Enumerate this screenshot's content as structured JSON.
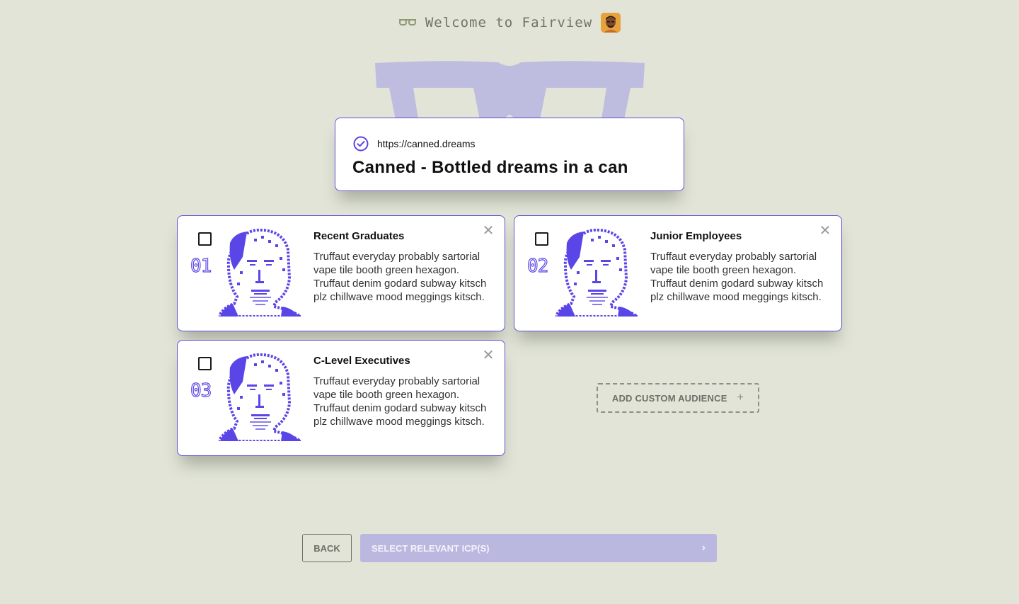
{
  "header": {
    "title": "Welcome to Fairview",
    "icon": "glasses-icon",
    "avatar": "user-avatar"
  },
  "site": {
    "url": "https://canned.dreams",
    "title": "Canned - Bottled dreams in a can",
    "status_icon": "check-circle-icon"
  },
  "icps": [
    {
      "number": "01",
      "name": "Recent Graduates",
      "description": "Truffaut everyday probably sartorial vape tile booth green hexagon. Truffaut denim godard subway kitsch plz chillwave mood meggings kitsch."
    },
    {
      "number": "02",
      "name": "Junior Employees",
      "description": "Truffaut everyday probably sartorial vape tile booth green hexagon. Truffaut denim godard subway kitsch plz chillwave mood meggings kitsch."
    },
    {
      "number": "03",
      "name": "C-Level Executives",
      "description": "Truffaut everyday probably sartorial vape tile booth green hexagon. Truffaut denim godard subway kitsch plz chillwave mood meggings kitsch."
    }
  ],
  "add_custom": {
    "label": "ADD CUSTOM AUDIENCE",
    "icon": "+"
  },
  "footer": {
    "back_label": "BACK",
    "next_label": "SELECT RELEVANT ICP(S)",
    "next_icon": "›"
  },
  "colors": {
    "background": "#e1e4d7",
    "accent": "#5a45e6",
    "accent_soft": "#bbb8df"
  }
}
